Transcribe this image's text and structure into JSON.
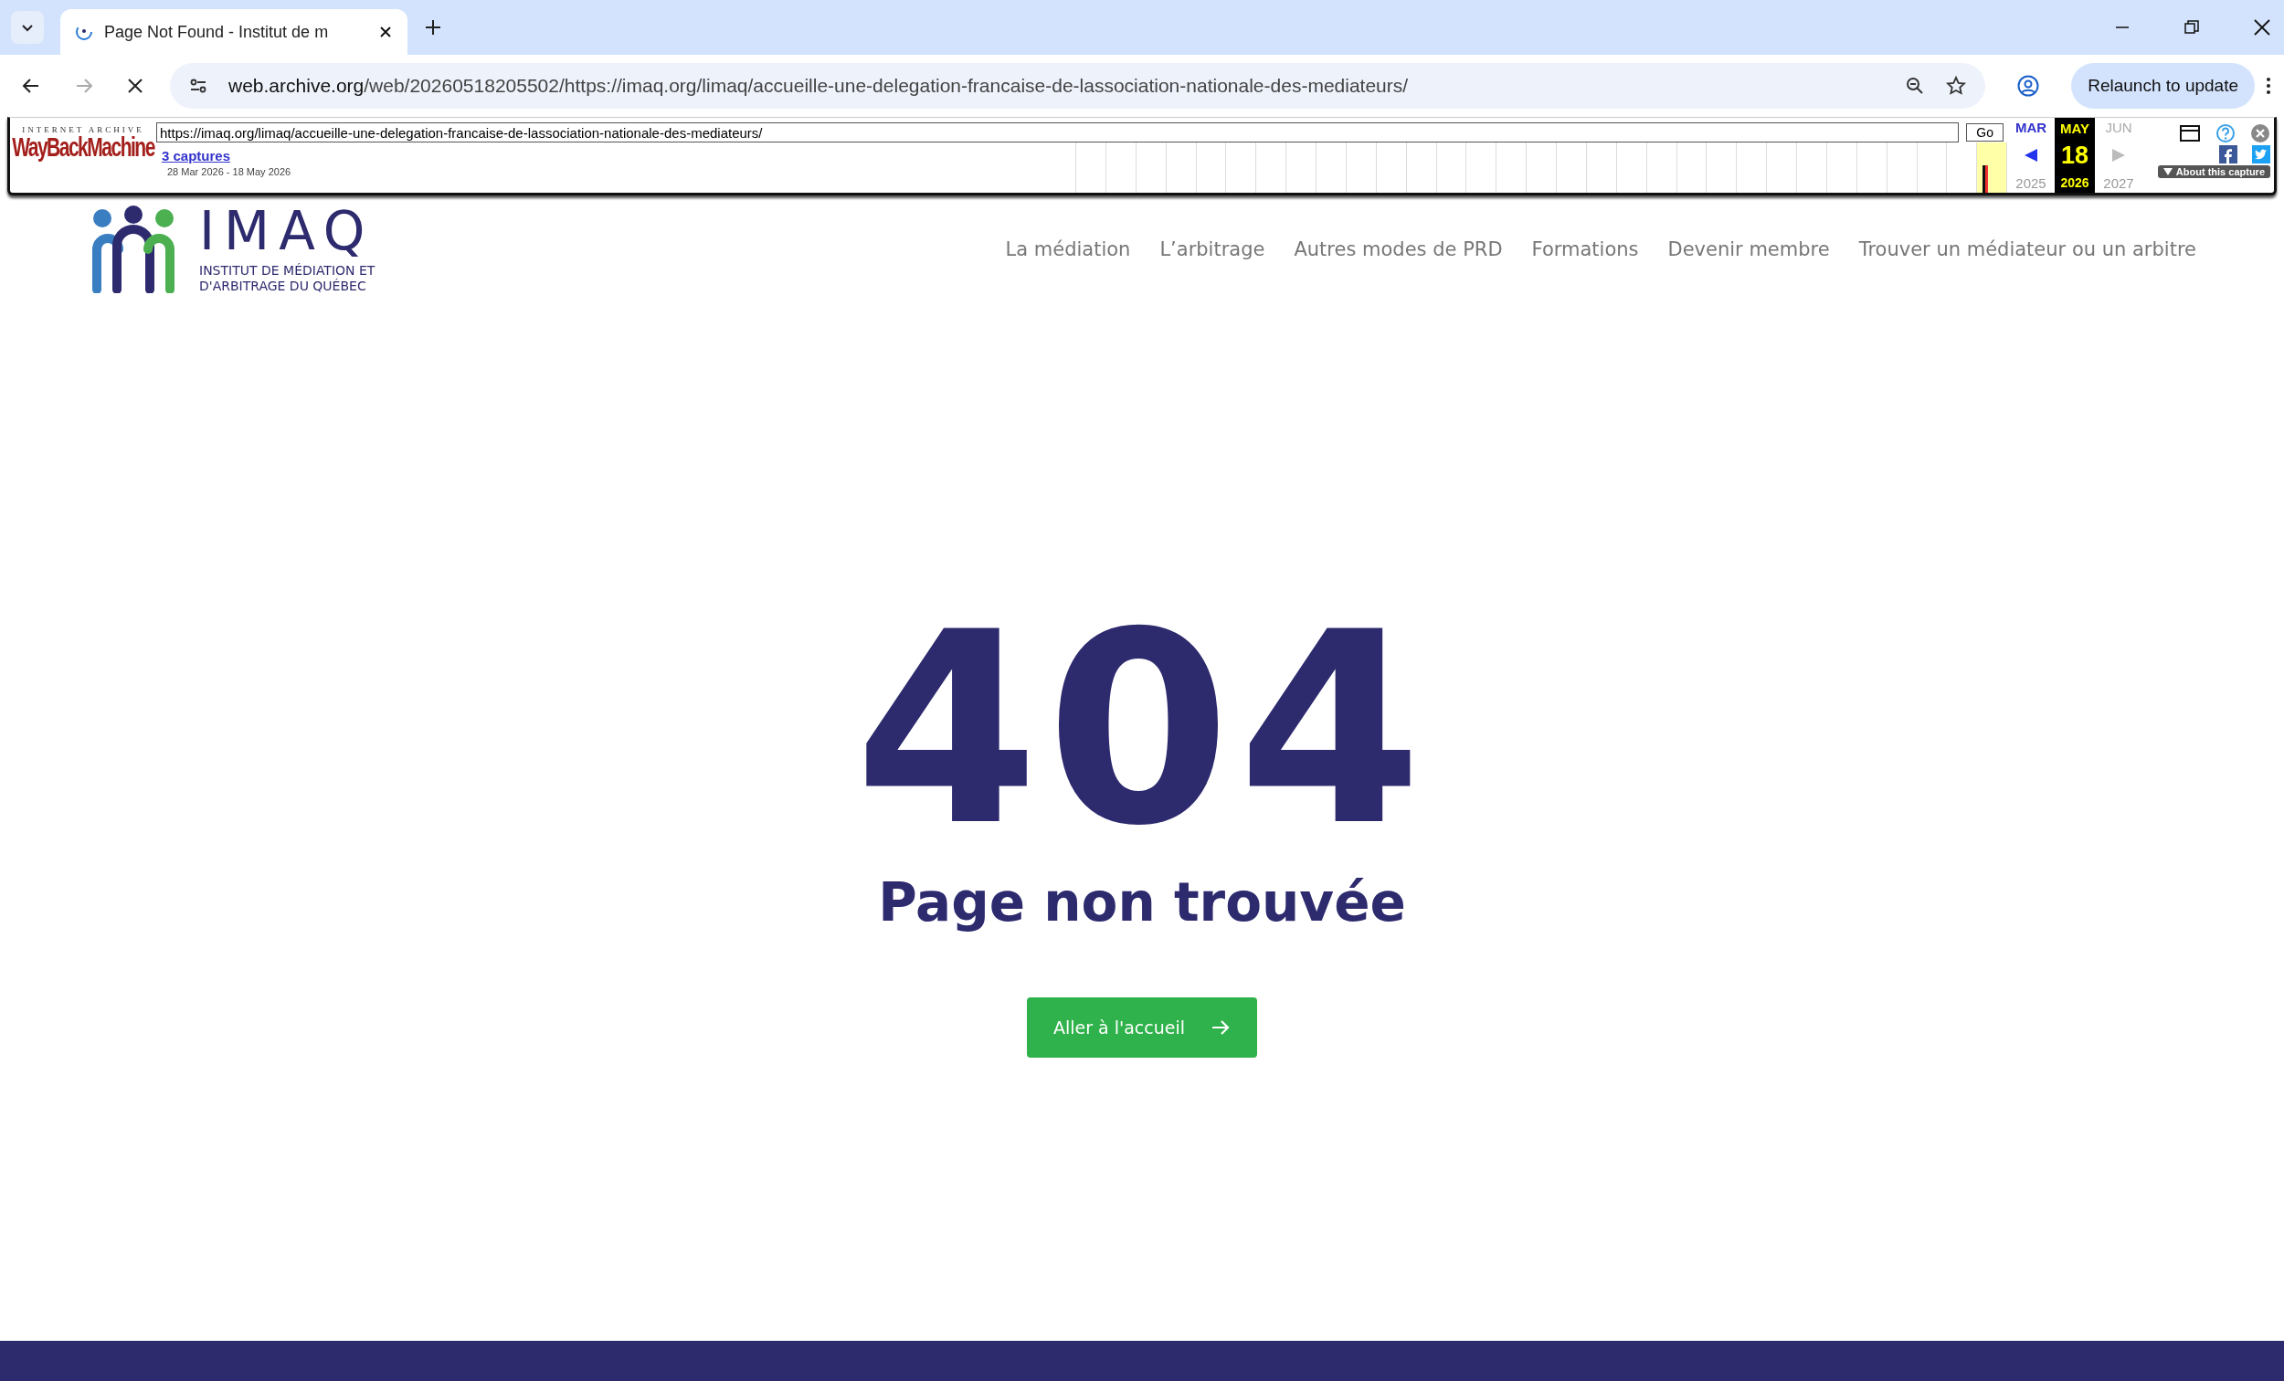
{
  "browser": {
    "tabs": [
      {
        "title": "Page Not Found - Institut de m",
        "selected": true
      }
    ],
    "url_host": "web.archive.org",
    "url_path": "/web/20260518205502/https://imaq.org/limaq/accueille-une-delegation-francaise-de-lassociation-nationale-des-mediateurs/",
    "loading": true,
    "relaunch": "Relaunch to update"
  },
  "wayback": {
    "brand_top": "INTERNET ARCHIVE",
    "brand": "WayBackMachine",
    "url": "https://imaq.org/limaq/accueille-une-delegation-francaise-de-lassociation-nationale-des-mediateurs/",
    "go": "Go",
    "captures": "3 captures",
    "range": "28 Mar 2026 - 18 May 2026",
    "prev_month": "MAR",
    "month": "MAY",
    "day": "18",
    "next_month": "JUN",
    "prev_year": "2025",
    "year": "2026",
    "next_year": "2027",
    "about": "About this capture"
  },
  "site": {
    "logo": "IMAQ",
    "logo_sub": [
      "INSTITUT DE MÉDIATION ET",
      "D'ARBITRAGE DU QUÉBEC"
    ],
    "nav": [
      "La médiation",
      "L’arbitrage",
      "Autres modes de PRD",
      "Formations",
      "Devenir membre",
      "Trouver un médiateur ou un arbitre"
    ]
  },
  "error": {
    "code": "404",
    "message": "Page non trouvée",
    "button": "Aller à l'accueil"
  }
}
